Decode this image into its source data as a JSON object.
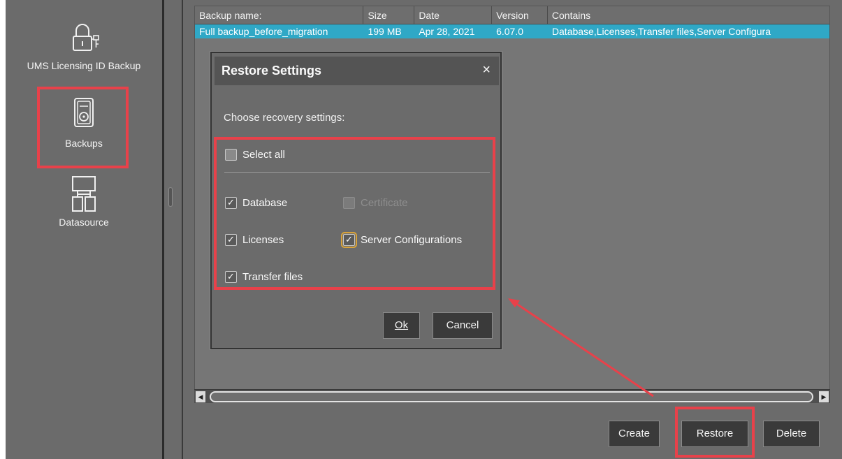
{
  "nav": {
    "items": [
      {
        "label": "UMS Licensing ID Backup",
        "icon": "lock-key-icon"
      },
      {
        "label": "Backups",
        "icon": "hard-disk-icon"
      },
      {
        "label": "Datasource",
        "icon": "network-icon"
      }
    ]
  },
  "table": {
    "columns": [
      "Backup name:",
      "Size",
      "Date",
      "Version",
      "Contains"
    ],
    "rows": [
      {
        "name": "Full backup_before_migration",
        "size": "199 MB",
        "date": "Apr 28, 2021",
        "version": "6.07.0",
        "contains": "Database,Licenses,Transfer files,Server Configura"
      }
    ]
  },
  "actions": {
    "create": "Create",
    "restore": "Restore",
    "delete": "Delete"
  },
  "dialog": {
    "title": "Restore Settings",
    "close": "×",
    "prompt": "Choose recovery settings:",
    "select_all": {
      "label": "Select all",
      "checked": false
    },
    "options": {
      "database": {
        "label": "Database",
        "checked": true
      },
      "certificate": {
        "label": "Certificate",
        "checked": false,
        "disabled": true
      },
      "licenses": {
        "label": "Licenses",
        "checked": true
      },
      "server_configurations": {
        "label": "Server Configurations",
        "checked": true
      },
      "transfer_files": {
        "label": "Transfer files",
        "checked": true
      }
    },
    "ok_label": "Ok",
    "cancel_label": "Cancel"
  },
  "colors": {
    "highlight": "#e8414a",
    "selection": "#2fa8c6",
    "panel": "#6b6b6b"
  }
}
